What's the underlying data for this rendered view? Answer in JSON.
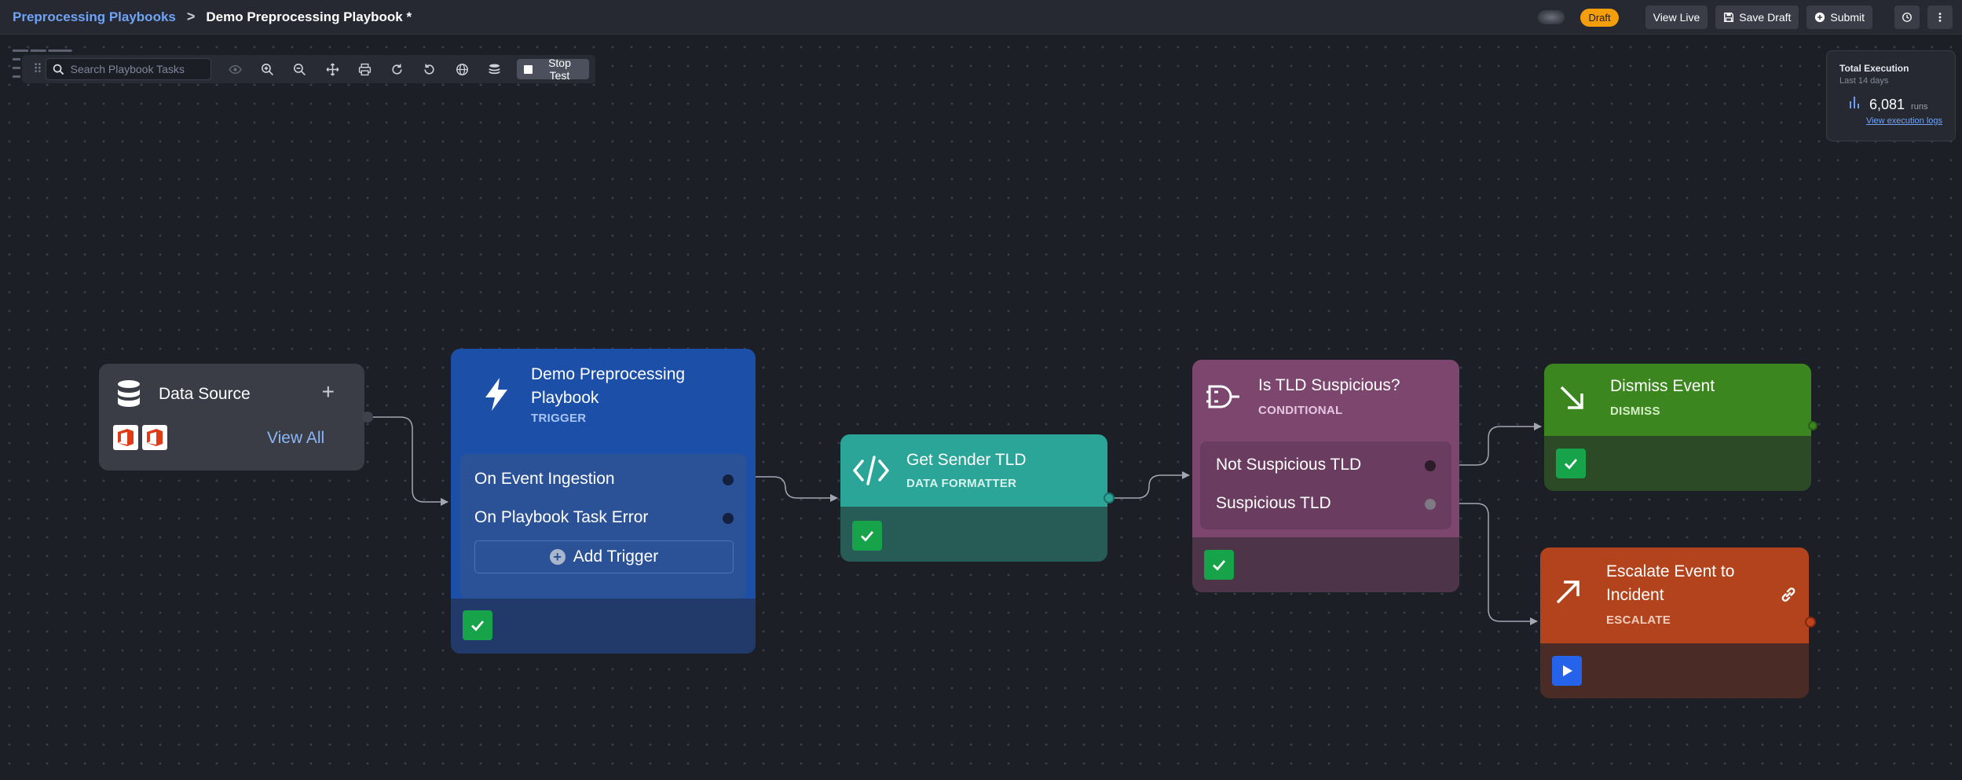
{
  "breadcrumb": {
    "parent": "Preprocessing Playbooks",
    "separator": ">",
    "current": "Demo Preprocessing Playbook *"
  },
  "header": {
    "status_badge": "Draft",
    "view_live": "View Live",
    "save_draft": "Save Draft",
    "submit": "Submit",
    "icons": [
      "history-icon",
      "more-vertical-icon"
    ]
  },
  "toolbar": {
    "search_placeholder": "Search Playbook Tasks",
    "stop_test": "Stop Test",
    "icons": [
      "eye-icon",
      "zoom-in-icon",
      "zoom-out-icon",
      "fit-view-icon",
      "print-icon",
      "redo-icon",
      "undo-icon",
      "globe-icon",
      "layers-icon"
    ]
  },
  "execution": {
    "title": "Total Execution",
    "subtitle": "Last 14 days",
    "count": "6,081",
    "unit": "runs",
    "link": "View execution logs"
  },
  "nodes": {
    "data_source": {
      "title": "Data Source",
      "add": "+",
      "view_all": "View All",
      "logos": [
        "office-365-icon",
        "office-365-icon"
      ]
    },
    "trigger": {
      "title": "Demo Preprocessing Playbook",
      "type": "TRIGGER",
      "rows": [
        "On Event Ingestion",
        "On Playbook Task Error"
      ],
      "add_trigger": "Add Trigger"
    },
    "formatter": {
      "title": "Get Sender TLD",
      "type": "DATA FORMATTER"
    },
    "conditional": {
      "title": "Is TLD Suspicious?",
      "type": "CONDITIONAL",
      "branches": [
        "Not Suspicious TLD",
        "Suspicious TLD"
      ]
    },
    "dismiss": {
      "title": "Dismiss Event",
      "type": "DISMISS"
    },
    "escalate": {
      "title_line1": "Escalate Event to",
      "title_line2": "Incident",
      "type": "ESCALATE"
    }
  },
  "colors": {
    "canvas_bg": "#1d1f27",
    "trigger": "#1b4fa8",
    "formatter": "#2aa597",
    "conditional": "#7c466f",
    "dismiss": "#3b861f",
    "escalate": "#b3431c",
    "draft": "#f59e0b",
    "success": "#16a34a",
    "run": "#2563eb"
  }
}
